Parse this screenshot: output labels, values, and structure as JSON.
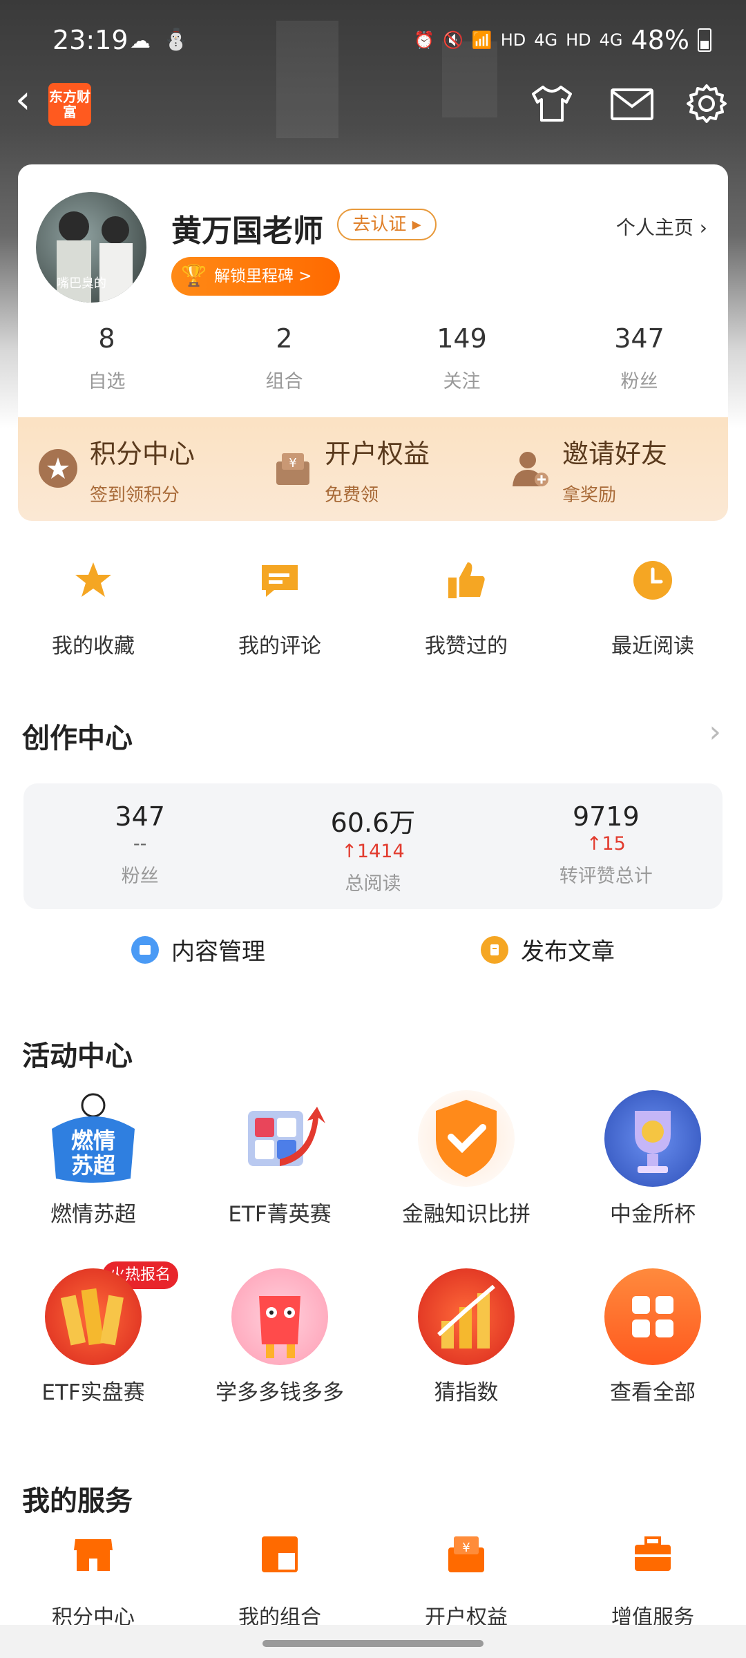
{
  "status_bar": {
    "time": "23:19",
    "net1": "HD",
    "net2": "4G",
    "net3": "HD",
    "net4": "4G",
    "battery": "48%"
  },
  "header": {
    "logo_text": "东方财富"
  },
  "profile": {
    "name": "黄万国老师",
    "verify_label": "去认证 ▸",
    "milestone_label": "解锁里程碑 >",
    "homepage_label": "个人主页",
    "avatar_watermark": "嘴巴臭的",
    "stats": [
      {
        "value": "8",
        "label": "自选"
      },
      {
        "value": "2",
        "label": "组合"
      },
      {
        "value": "149",
        "label": "关注"
      },
      {
        "value": "347",
        "label": "粉丝"
      }
    ]
  },
  "perks": [
    {
      "title": "积分中心",
      "sub": "签到领积分"
    },
    {
      "title": "开户权益",
      "sub": "免费领"
    },
    {
      "title": "邀请好友",
      "sub": "拿奖励"
    }
  ],
  "quick": [
    {
      "label": "我的收藏",
      "icon": "star-icon"
    },
    {
      "label": "我的评论",
      "icon": "comment-icon"
    },
    {
      "label": "我赞过的",
      "icon": "thumbs-up-icon"
    },
    {
      "label": "最近阅读",
      "icon": "clock-icon"
    }
  ],
  "creation": {
    "title": "创作中心",
    "metrics": [
      {
        "value": "347",
        "delta": "--",
        "label": "粉丝"
      },
      {
        "value": "60.6万",
        "delta": "↑1414",
        "label": "总阅读"
      },
      {
        "value": "9719",
        "delta": "↑15",
        "label": "转评赞总计"
      }
    ],
    "actions": {
      "manage": "内容管理",
      "publish": "发布文章"
    }
  },
  "activity": {
    "title": "活动中心",
    "hot_badge": "火热报名",
    "items": [
      {
        "label": "燃情苏超",
        "art": "燃情苏超"
      },
      {
        "label": "ETF菁英赛"
      },
      {
        "label": "金融知识比拼"
      },
      {
        "label": "中金所杯"
      },
      {
        "label": "ETF实盘赛"
      },
      {
        "label": "学多多钱多多"
      },
      {
        "label": "猜指数"
      },
      {
        "label": "查看全部"
      }
    ]
  },
  "services": {
    "title": "我的服务",
    "items": [
      {
        "label": "积分中心"
      },
      {
        "label": "我的组合"
      },
      {
        "label": "开户权益"
      },
      {
        "label": "增值服务"
      }
    ]
  },
  "colors": {
    "accent": "#ff6a00",
    "up": "#e23b2e",
    "perk_bg": "#fbe2c3"
  }
}
